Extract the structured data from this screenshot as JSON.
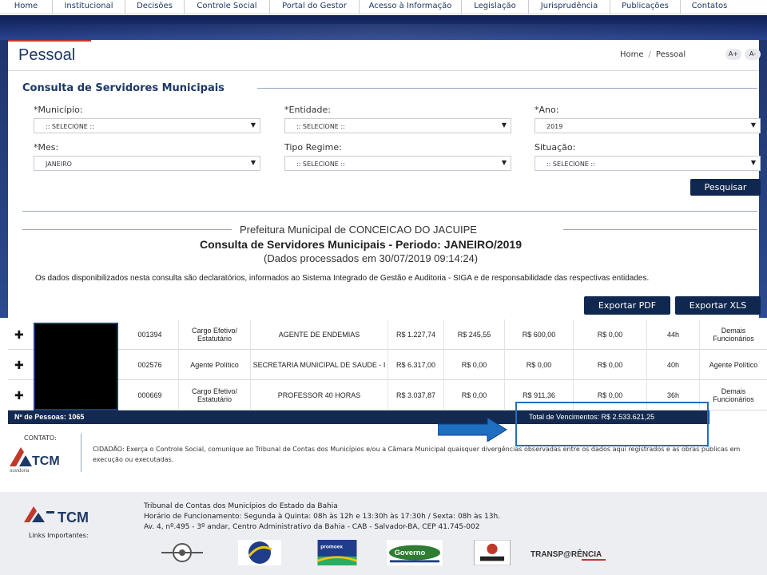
{
  "nav": [
    "Home",
    "Institucional",
    "Decisões",
    "Controle Social",
    "Portal do Gestor",
    "Acesso à Informação",
    "Legislação",
    "Jurisprudência",
    "Publicações",
    "Contatos"
  ],
  "header": {
    "title": "Pessoal",
    "breadcrumb_home": "Home",
    "breadcrumb_current": "Pessoal",
    "font_increase": "A+",
    "font_decrease": "A-"
  },
  "form": {
    "section_title": "Consulta de Servidores Municipais",
    "municipio_label": "*Município:",
    "municipio_value": ":: SELECIONE ::",
    "entidade_label": "*Entidade:",
    "entidade_value": ":: SELECIONE ::",
    "ano_label": "*Ano:",
    "ano_value": "2019",
    "mes_label": "*Mes:",
    "mes_value": "JANEIRO",
    "regime_label": "Tipo Regime:",
    "regime_value": ":: SELECIONE ::",
    "situacao_label": "Situação:",
    "situacao_value": ":: SELECIONE ::",
    "search_button": "Pesquisar"
  },
  "results": {
    "prefeitura": "Prefeitura Municipal de CONCEICAO DO JACUIPE",
    "title": "Consulta de Servidores Municipais - Periodo: JANEIRO/2019",
    "processed": "(Dados processados em 30/07/2019 09:14:24)",
    "disclaimer": "Os dados disponibilizados nesta consulta são declaratórios, informados ao Sistema Integrado de Gestão e Auditoria - SIGA e de responsabilidade das respectivas entidades.",
    "export_pdf": "Exportar PDF",
    "export_xls": "Exportar XLS"
  },
  "rows": [
    {
      "matricula": "001394",
      "tipo": "Cargo Efetivo/ Estatutário",
      "cargo": "AGENTE DE ENDEMIAS",
      "salario": "R$ 1.227,74",
      "v1": "R$ 245,55",
      "v2": "R$ 600,00",
      "v3": "R$ 0,00",
      "horas": "44h",
      "categoria": "Demais Funcionários"
    },
    {
      "matricula": "002576",
      "tipo": "Agente Político",
      "cargo": "SECRETARIA MUNICIPAL DE SAUDE - I",
      "salario": "R$ 6.317,00",
      "v1": "R$ 0,00",
      "v2": "R$ 0,00",
      "v3": "R$ 0,00",
      "horas": "40h",
      "categoria": "Agente Político"
    },
    {
      "matricula": "000669",
      "tipo": "Cargo Efetivo/ Estatutário",
      "cargo": "PROFESSOR 40 HORAS",
      "salario": "R$ 3.037,87",
      "v1": "R$ 0,00",
      "v2": "R$ 911,36",
      "v3": "R$ 0,00",
      "horas": "36h",
      "categoria": "Demais Funcionários"
    }
  ],
  "summary": {
    "pessoas": "Nº de Pessoas: 1065",
    "total": "Total de Vencimentos: R$ 2.533.621,25"
  },
  "contact": {
    "label": "CONTATO:",
    "logo_text": "TCM",
    "logo_sub": "ouvidoria",
    "text": "CIDADÃO: Exerça o Controle Social, comunique ao Tribunal de Contas dos Municípios e/ou a Câmara Municipal quaisquer divergências observadas entre os dados aqui registrados e as obras públicas em execução ou executadas."
  },
  "footer": {
    "logo_text": "TCM",
    "line1": "Tribunal de Contas dos Municípios do Estado da Bahia",
    "line2": "Horário de Funcionamento: Segunda à Quinta: 08h às 12h e 13:30h às 17:30h / Sexta: 08h às 13h.",
    "line3": "Av. 4, nº.495 - 3º andar, Centro Administrativo da Bahia - CAB - Salvador-BA, CEP 41.745-002",
    "links_label": "Links Importantes:",
    "logo_promoex": "promoex",
    "logo_governo": "Governo",
    "logo_transparencia": "TRANSP@RÊNCIA"
  },
  "colors": {
    "navy": "#13294f",
    "accent_blue": "#1f6fc1",
    "title_blue": "#1d3866",
    "red_accent": "#c0392b"
  }
}
